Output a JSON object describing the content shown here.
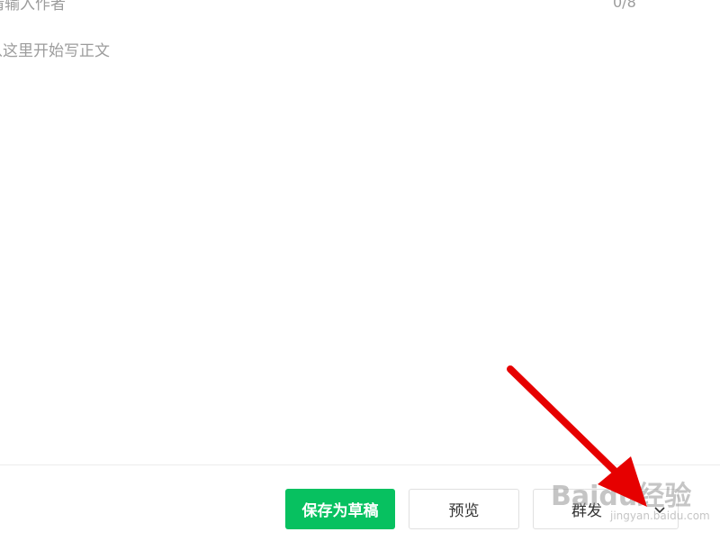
{
  "editor": {
    "author_placeholder": "请输入作者",
    "author_count": "0/8",
    "body_placeholder": "从这里开始写正文"
  },
  "toolbar": {
    "save_draft_label": "保存为草稿",
    "preview_label": "预览",
    "publish_label": "群发"
  },
  "colors": {
    "accent_green": "#07c160",
    "annotation_arrow": "#e60000"
  },
  "watermark": {
    "brand": "Baidu经验",
    "url": "jingyan.baidu.com"
  },
  "icons": {
    "dropdown": "chevron-down-icon",
    "annotation": "red-arrow"
  }
}
